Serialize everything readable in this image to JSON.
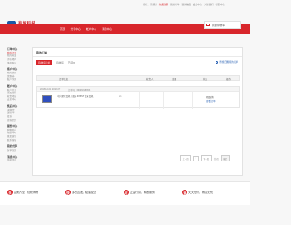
{
  "topbar": {
    "links": [
      "您好，请登录",
      "免费注册",
      "我的订单",
      "我的收藏",
      "会员中心",
      "关注我们",
      "客服中心"
    ]
  },
  "logo": {
    "mark": "ZH",
    "cn": "兆坤科技",
    "en": "dhwb.com"
  },
  "cart": {
    "label": "我的购物车"
  },
  "nav": {
    "items": [
      "首页",
      "分享中心",
      "帐户中心",
      "消息中心"
    ]
  },
  "sidebar": [
    {
      "title": "订单中心",
      "items": [
        "我的订单",
        "我的收藏",
        "评价晒单",
        "维修服务"
      ]
    },
    {
      "title": "客户中心",
      "items": [
        "我的优惠",
        "优惠券",
        "账户余额"
      ]
    },
    {
      "title": "账户中心",
      "items": [
        "账户信息",
        "修改密码",
        "收货地址",
        "安全中心"
      ]
    },
    {
      "title": "售后中心",
      "items": [
        "退换货",
        "维修单",
        "投诉",
        "咨询回复"
      ]
    },
    {
      "title": "服务中心",
      "items": [
        "购物助手",
        "帮助中心",
        "意见建议",
        "联系客服"
      ]
    },
    {
      "title": "我的分享",
      "items": [
        "分享记录"
      ]
    },
    {
      "title": "消息中心",
      "items": [
        "系统消息"
      ]
    }
  ],
  "main": {
    "heading": "我的订单",
    "tabs": [
      "待收货订单",
      "待收货",
      "已评价"
    ],
    "recycle": "查找已删除的订单",
    "columns": [
      "订单信息",
      "收货人",
      "金额",
      "状态",
      "操作"
    ],
    "order": {
      "date": "2018-12-01 20:32:27",
      "order_no": "订单号：69081638653",
      "product": "中兴星星耳机 | 双向 ZX5ST 蓝牙耳机",
      "qty": "x1",
      "status": "已取消",
      "detail": "查看订单"
    },
    "pager": {
      "prev": "上一页",
      "page": "1",
      "next": "下一页",
      "total": "共1页",
      "go": "确定"
    }
  },
  "footer": [
    {
      "glyph": "多",
      "text": "品类齐全，轻松购物"
    },
    {
      "glyph": "快",
      "text": "多仓直发，极速配送"
    },
    {
      "glyph": "好",
      "text": "正品行货，精致服务"
    },
    {
      "glyph": "省",
      "text": "天天低价，畅选无忧"
    }
  ],
  "colors": {
    "brand": "#d8262b",
    "link": "#1f5ab0",
    "logo": "#1b58a6"
  }
}
